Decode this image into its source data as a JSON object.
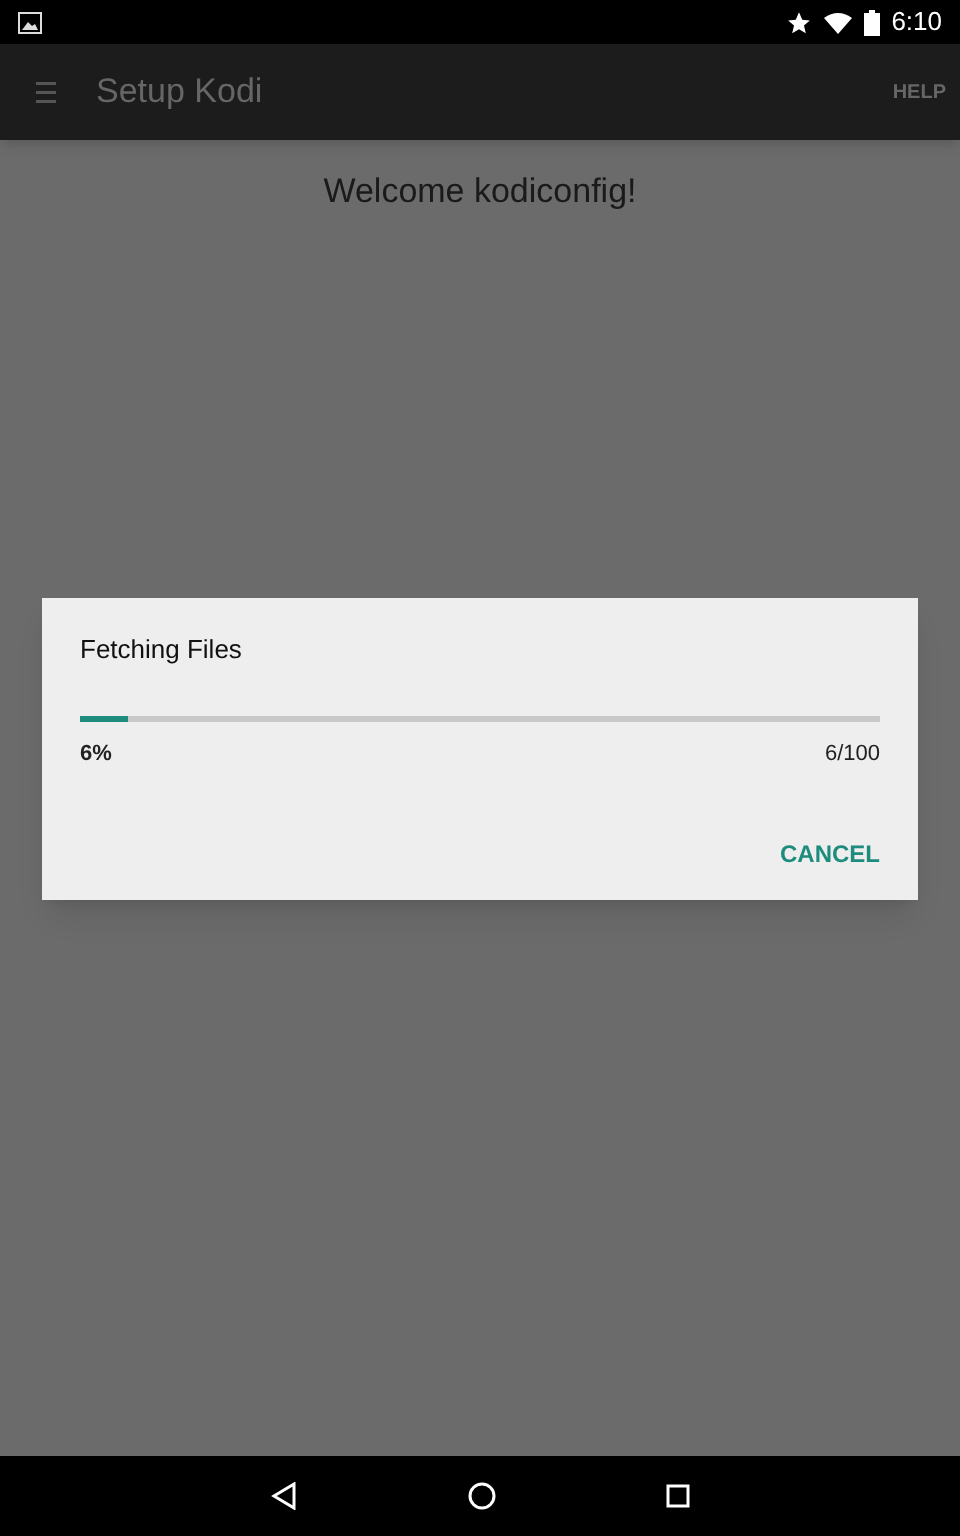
{
  "status_bar": {
    "time": "6:10"
  },
  "app_bar": {
    "title": "Setup Kodi",
    "action": "HELP"
  },
  "heading": "Welcome kodiconfig!",
  "dialog": {
    "title": "Fetching Files",
    "progress": {
      "level": 0.06
    },
    "percent": "6%",
    "count": "6/100",
    "button": "CANCEL"
  }
}
